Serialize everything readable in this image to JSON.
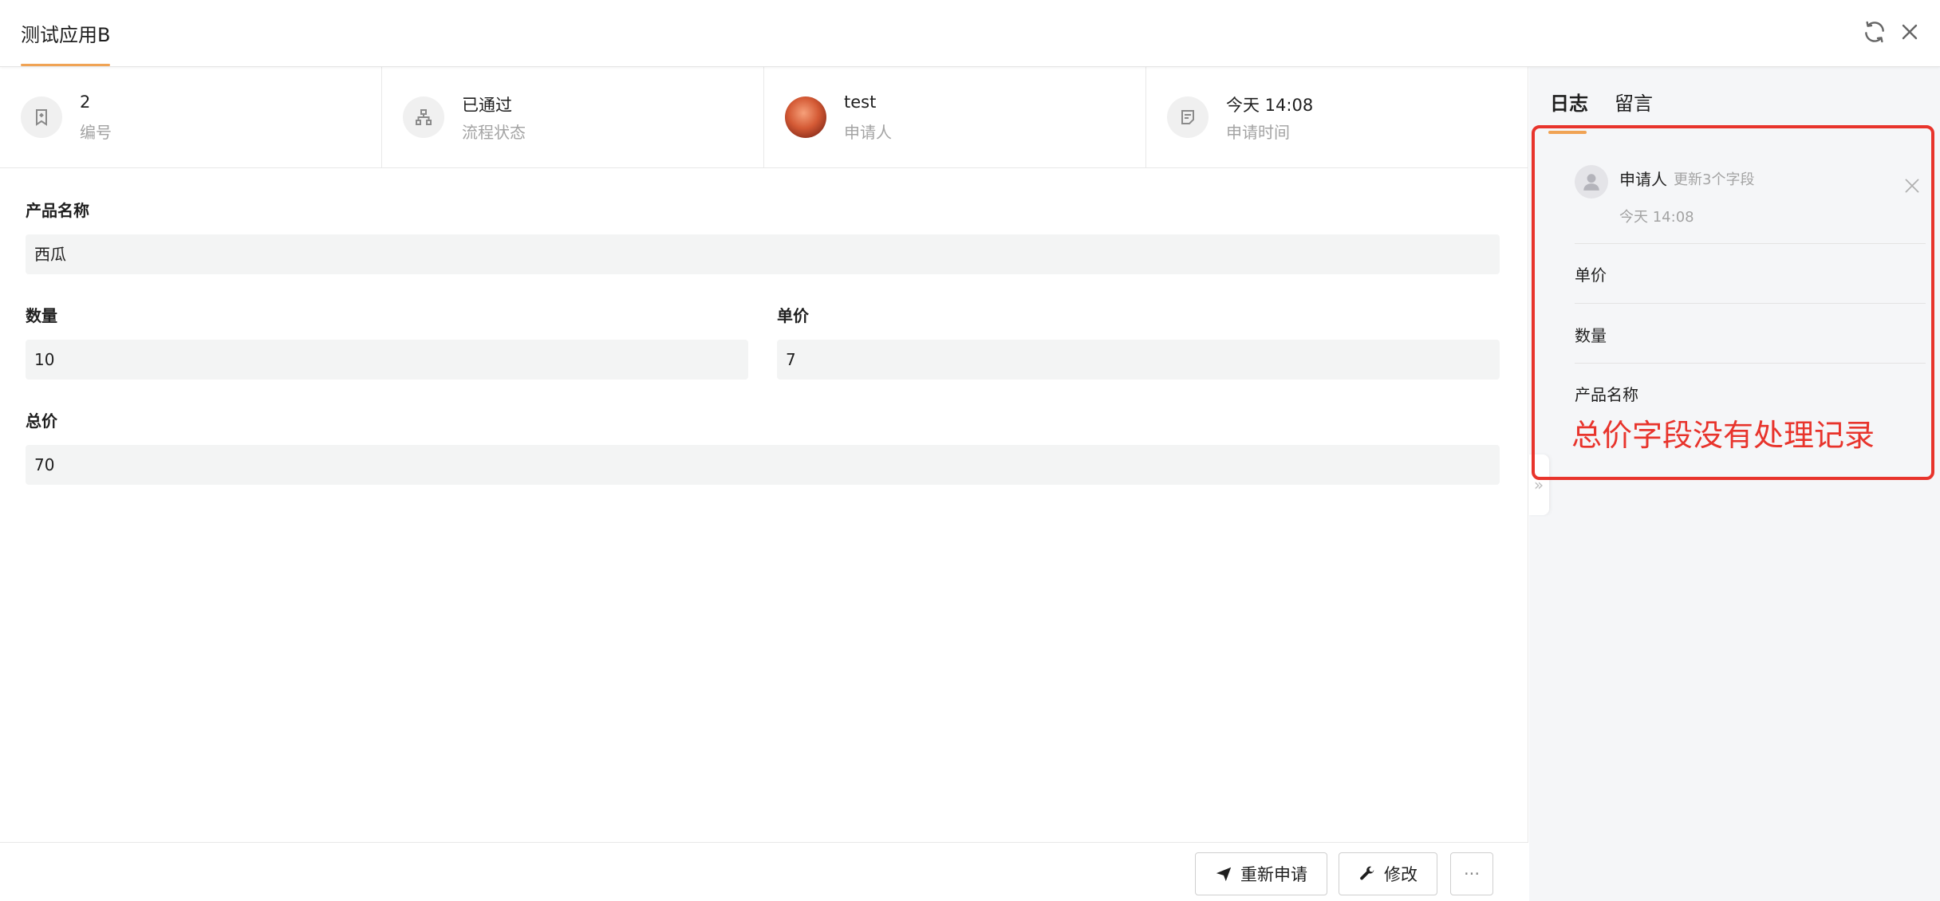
{
  "header": {
    "title": "测试应用B",
    "refresh_icon": "refresh-icon",
    "close_icon": "close-icon"
  },
  "info": [
    {
      "value": "2",
      "label": "编号",
      "icon": "bookmark-icon"
    },
    {
      "value": "已通过",
      "label": "流程状态",
      "icon": "flowchart-icon"
    },
    {
      "value": "test",
      "label": "申请人",
      "icon": "avatar"
    },
    {
      "value": "今天 14:08",
      "label": "申请时间",
      "icon": "note-icon"
    }
  ],
  "form": {
    "product_name": {
      "label": "产品名称",
      "value": "西瓜"
    },
    "quantity": {
      "label": "数量",
      "value": "10"
    },
    "unit_price": {
      "label": "单价",
      "value": "7"
    },
    "total_price": {
      "label": "总价",
      "value": "70"
    }
  },
  "footer": {
    "reapply_label": "重新申请",
    "edit_label": "修改",
    "more_label": "···"
  },
  "right_panel": {
    "tabs": [
      {
        "label": "日志",
        "active": true
      },
      {
        "label": "留言",
        "active": false
      }
    ],
    "log": {
      "user": "申请人",
      "action": "更新3个字段",
      "time": "今天 14:08",
      "fields": [
        "单价",
        "数量",
        "产品名称"
      ]
    },
    "annotation": "总价字段没有处理记录"
  },
  "colors": {
    "accent": "#f0a354",
    "annotation_red": "#e8342c"
  }
}
